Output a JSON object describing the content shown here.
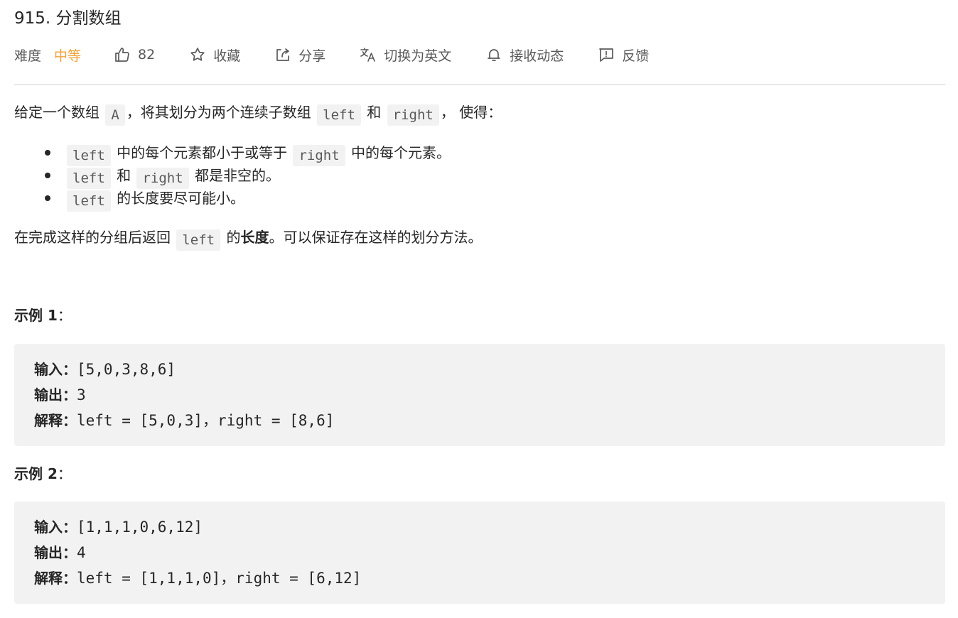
{
  "problem": {
    "title": "915. 分割数组"
  },
  "meta": {
    "difficulty_label": "难度",
    "difficulty_value": "中等",
    "likes_count": "82",
    "favorite_label": "收藏",
    "share_label": "分享",
    "translate_label": "切换为英文",
    "notify_label": "接收动态",
    "feedback_label": "反馈",
    "icons": {
      "like": "thumbs-up-icon",
      "favorite": "star-icon",
      "share": "share-icon",
      "translate": "translate-icon",
      "notify": "bell-icon",
      "feedback": "feedback-icon"
    },
    "difficulty_color": "#f0a23a"
  },
  "description": {
    "intro": {
      "p1": "给定一个数组 ",
      "code_a": "A",
      "p2": "，将其划分为两个连续子数组 ",
      "code_left": "left",
      "p3": " 和 ",
      "code_right": "right",
      "p4": "，  使得："
    },
    "bullets": [
      {
        "code1": "left",
        "text1": " 中的每个元素都小于或等于 ",
        "code2": "right",
        "text2": " 中的每个元素。"
      },
      {
        "code1": "left",
        "text1": " 和 ",
        "code2": "right",
        "text2": " 都是非空的。"
      },
      {
        "code1": "left",
        "text1": " 的长度要尽可能小。"
      }
    ],
    "return_line": {
      "p1": "在完成这样的分组后返回 ",
      "code": "left",
      "p2": " 的",
      "bold": "长度",
      "p3": "。可以保证存在这样的划分方法。"
    }
  },
  "examples": [
    {
      "title_prefix": "示例 ",
      "title_num": "1",
      "title_suffix": "：",
      "input_label": "输入：",
      "input_value": "[5,0,3,8,6]",
      "output_label": "输出：",
      "output_value": "3",
      "explain_label": "解释：",
      "explain_value": "left = [5,0,3]，right = [8,6]"
    },
    {
      "title_prefix": "示例 ",
      "title_num": "2",
      "title_suffix": "：",
      "input_label": "输入：",
      "input_value": "[1,1,1,0,6,12]",
      "output_label": "输出：",
      "output_value": "4",
      "explain_label": "解释：",
      "explain_value": "left = [1,1,1,0]，right = [6,12]"
    }
  ]
}
